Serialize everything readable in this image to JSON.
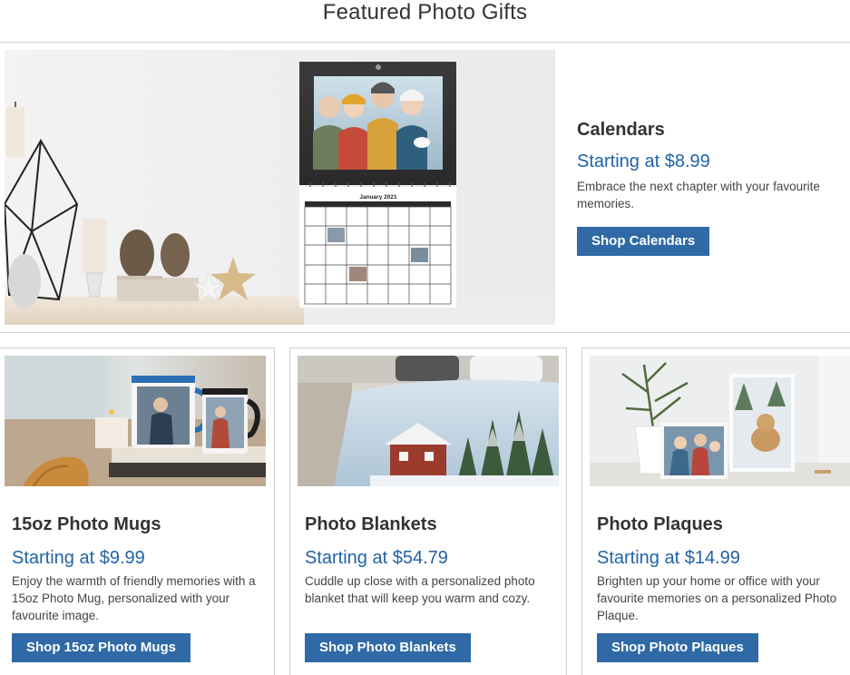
{
  "page": {
    "title": "Featured Photo Gifts"
  },
  "featured": {
    "title": "Calendars",
    "price": "Starting at $8.99",
    "description": "Embrace the next chapter with your favourite memories.",
    "button": "Shop Calendars",
    "calendar_month": "January 2021"
  },
  "cards": [
    {
      "title": "15oz Photo Mugs",
      "price": "Starting at $9.99",
      "description": "Enjoy the warmth of friendly memories with a 15oz Photo Mug, personalized with your favourite image.",
      "button": "Shop 15oz Photo Mugs"
    },
    {
      "title": "Photo Blankets",
      "price": "Starting at $54.79",
      "description": "Cuddle up close with a personalized photo blanket that will keep you warm and cozy.",
      "button": "Shop Photo Blankets"
    },
    {
      "title": "Photo Plaques",
      "price": "Starting at $14.99",
      "description": "Brighten up your home or office with your favourite memories on a personalized Photo Plaque.",
      "button": "Shop Photo Plaques"
    }
  ],
  "colors": {
    "price": "#1f63a6",
    "button": "#2f6aa6",
    "divider": "#cfcfcf"
  }
}
